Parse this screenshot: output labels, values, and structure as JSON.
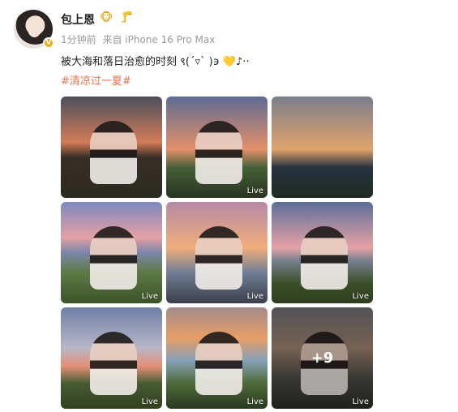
{
  "post": {
    "username": "包上恩",
    "badge1": "🐵",
    "badge2": "🦵",
    "verified_mark": "V",
    "time": "1分钟前",
    "source": "来自 iPhone 16 Pro Max",
    "text": "被大海和落日治愈的时刻 ९(´▿` )϶ ",
    "emoji": "💛",
    "text_tail": "♪‧‧",
    "hashtag": "#清凉过一夏#"
  },
  "photos": [
    {
      "name": "photo-1",
      "live": ""
    },
    {
      "name": "photo-2",
      "live": "Live"
    },
    {
      "name": "photo-3",
      "live": ""
    },
    {
      "name": "photo-4",
      "live": "Live"
    },
    {
      "name": "photo-5",
      "live": "Live"
    },
    {
      "name": "photo-6",
      "live": "Live"
    },
    {
      "name": "photo-7",
      "live": "Live"
    },
    {
      "name": "photo-8",
      "live": "Live"
    },
    {
      "name": "photo-9",
      "live": "Live",
      "more": "+9"
    }
  ],
  "colors": {
    "hashtag": "#eb7350",
    "meta": "#999999",
    "verify_badge": "#f7a600"
  }
}
